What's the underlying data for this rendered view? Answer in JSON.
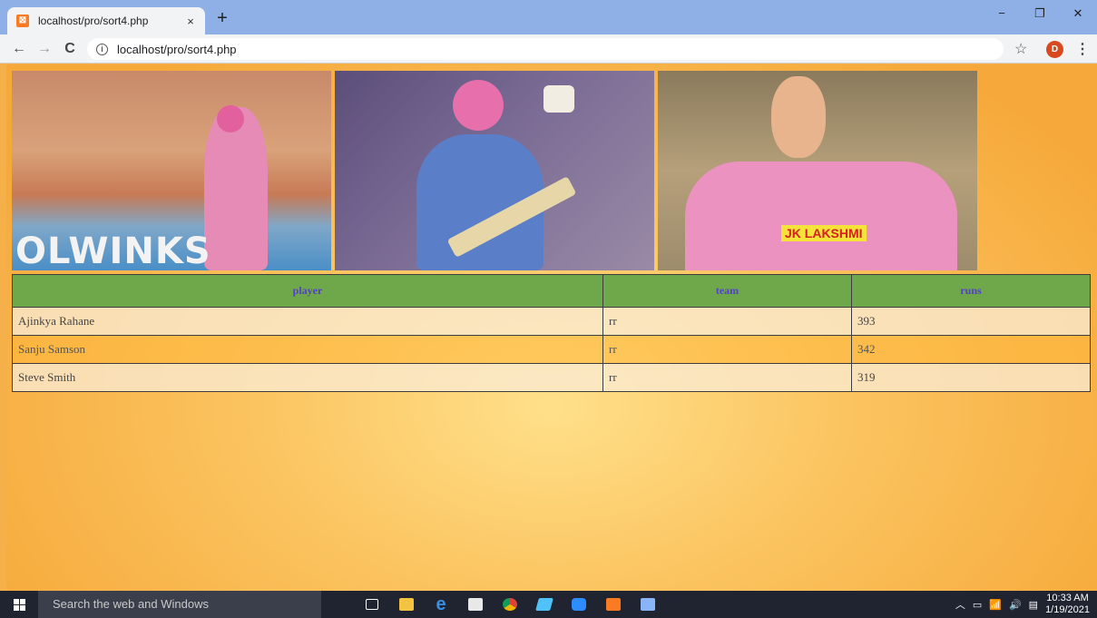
{
  "browser": {
    "tab_title": "localhost/pro/sort4.php",
    "tab_close_glyph": "×",
    "new_tab_glyph": "+",
    "url": "localhost/pro/sort4.php",
    "avatar_letter": "D",
    "window_controls": {
      "minimize": "−",
      "restore": "❐",
      "close": "✕"
    },
    "favicon_icon": "xampp-icon",
    "favicon_glyph": "⊠"
  },
  "photos": {
    "banner_text": "OLWINKS",
    "sponsor_text": "JK LAKSHMI"
  },
  "table": {
    "headers": [
      "player",
      "team",
      "runs"
    ],
    "rows": [
      {
        "player": "Ajinkya Rahane",
        "team": "rr",
        "runs": "393"
      },
      {
        "player": "Sanju Samson",
        "team": "rr",
        "runs": "342"
      },
      {
        "player": "Steve Smith",
        "team": "rr",
        "runs": "319"
      }
    ]
  },
  "taskbar": {
    "search_placeholder": "Search the web and Windows",
    "time": "10:33 AM",
    "date": "1/19/2021"
  },
  "colors": {
    "header_bg": "#6fa84a",
    "header_text": "#5340c8",
    "page_bg": "#f6b04a"
  }
}
